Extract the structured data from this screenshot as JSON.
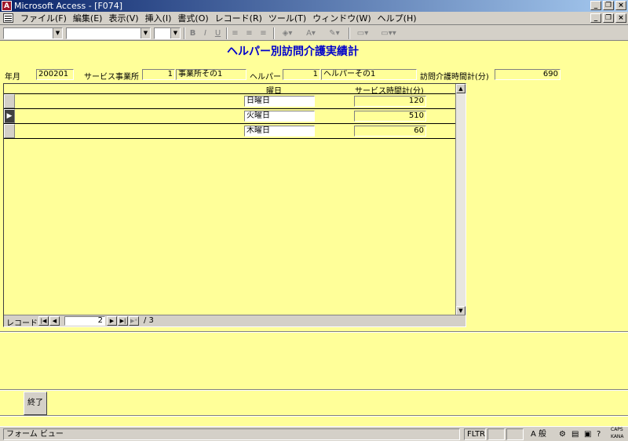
{
  "window": {
    "title": "Microsoft Access - [F074]",
    "app_icon": "access-key-icon"
  },
  "menu": [
    "ファイル(F)",
    "編集(E)",
    "表示(V)",
    "挿入(I)",
    "書式(O)",
    "レコード(R)",
    "ツール(T)",
    "ウィンドウ(W)",
    "ヘルプ(H)"
  ],
  "form": {
    "title": "ヘルパー別訪問介護実績計",
    "year_month_label": "年月",
    "year_month_value": "200201",
    "office_label": "サービス事業所",
    "office_id": "1",
    "office_name": "事業所その1",
    "helper_label": "ヘルパー",
    "helper_id": "1",
    "helper_name": "ヘルパーその1",
    "total_label": "訪問介護時間計(分)",
    "total_value": "690"
  },
  "subform": {
    "col_weekday": "曜日",
    "col_minutes": "サービス時間計(分)",
    "rows": [
      {
        "weekday": "日曜日",
        "minutes": "120",
        "selector": ""
      },
      {
        "weekday": "火曜日",
        "minutes": "510",
        "selector": "▶"
      },
      {
        "weekday": "木曜日",
        "minutes": "60",
        "selector": ""
      }
    ],
    "nav": {
      "label": "レコード:",
      "current": "2",
      "total": "/ 3"
    }
  },
  "buttons": {
    "end": "終了"
  },
  "status": {
    "view": "フォーム ビュー",
    "fltr": "FLTR",
    "ime_mode": "A 般",
    "caps": "CAPS",
    "kana": "KANA"
  }
}
